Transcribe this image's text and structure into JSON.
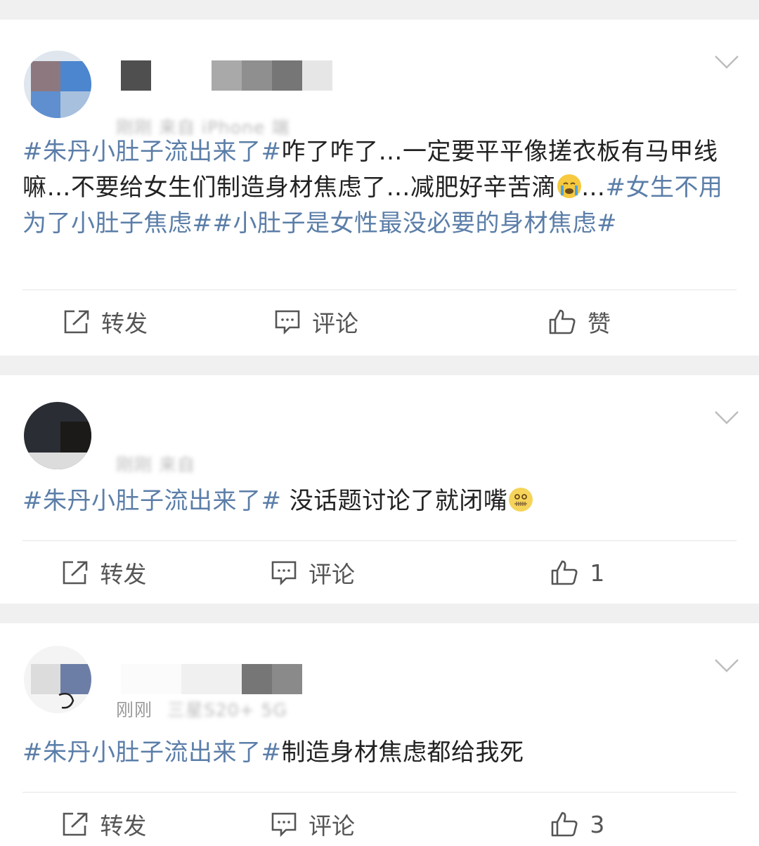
{
  "posts": [
    {
      "meta_visible": "刚刚",
      "meta_blurred": "来自 iPhone 端",
      "content": {
        "tag1": "#朱丹小肚子流出来了#",
        "text": "咋了咋了…一定要平平像搓衣板有马甲线嘛…不要给女生们制造身材焦虑了…减肥好辛苦滴",
        "emoji": "crying-face",
        "after_emoji": "…",
        "tag2": "#女生不用为了小肚子焦虑#",
        "tag3": "#小肚子是女性最没必要的身材焦虑#"
      },
      "actions": {
        "repost": "转发",
        "comment": "评论",
        "like": "赞"
      }
    },
    {
      "meta_visible": "刚刚",
      "meta_blurred": "来自",
      "content": {
        "tag1": "#朱丹小肚子流出来了#",
        "text": " 没话题讨论了就闭嘴",
        "emoji": "zipper-mouth-face"
      },
      "actions": {
        "repost": "转发",
        "comment": "评论",
        "like": "1"
      }
    },
    {
      "meta_visible": "刚刚",
      "meta_blurred": "三星S20+ 5G",
      "content": {
        "tag1": "#朱丹小肚子流出来了#",
        "text": "制造身材焦虑都给我死"
      },
      "actions": {
        "repost": "转发",
        "comment": "评论",
        "like": "3"
      }
    }
  ],
  "colors": {
    "tag": "#5b7ea8",
    "background": "#f0f0f0",
    "card": "#ffffff"
  }
}
